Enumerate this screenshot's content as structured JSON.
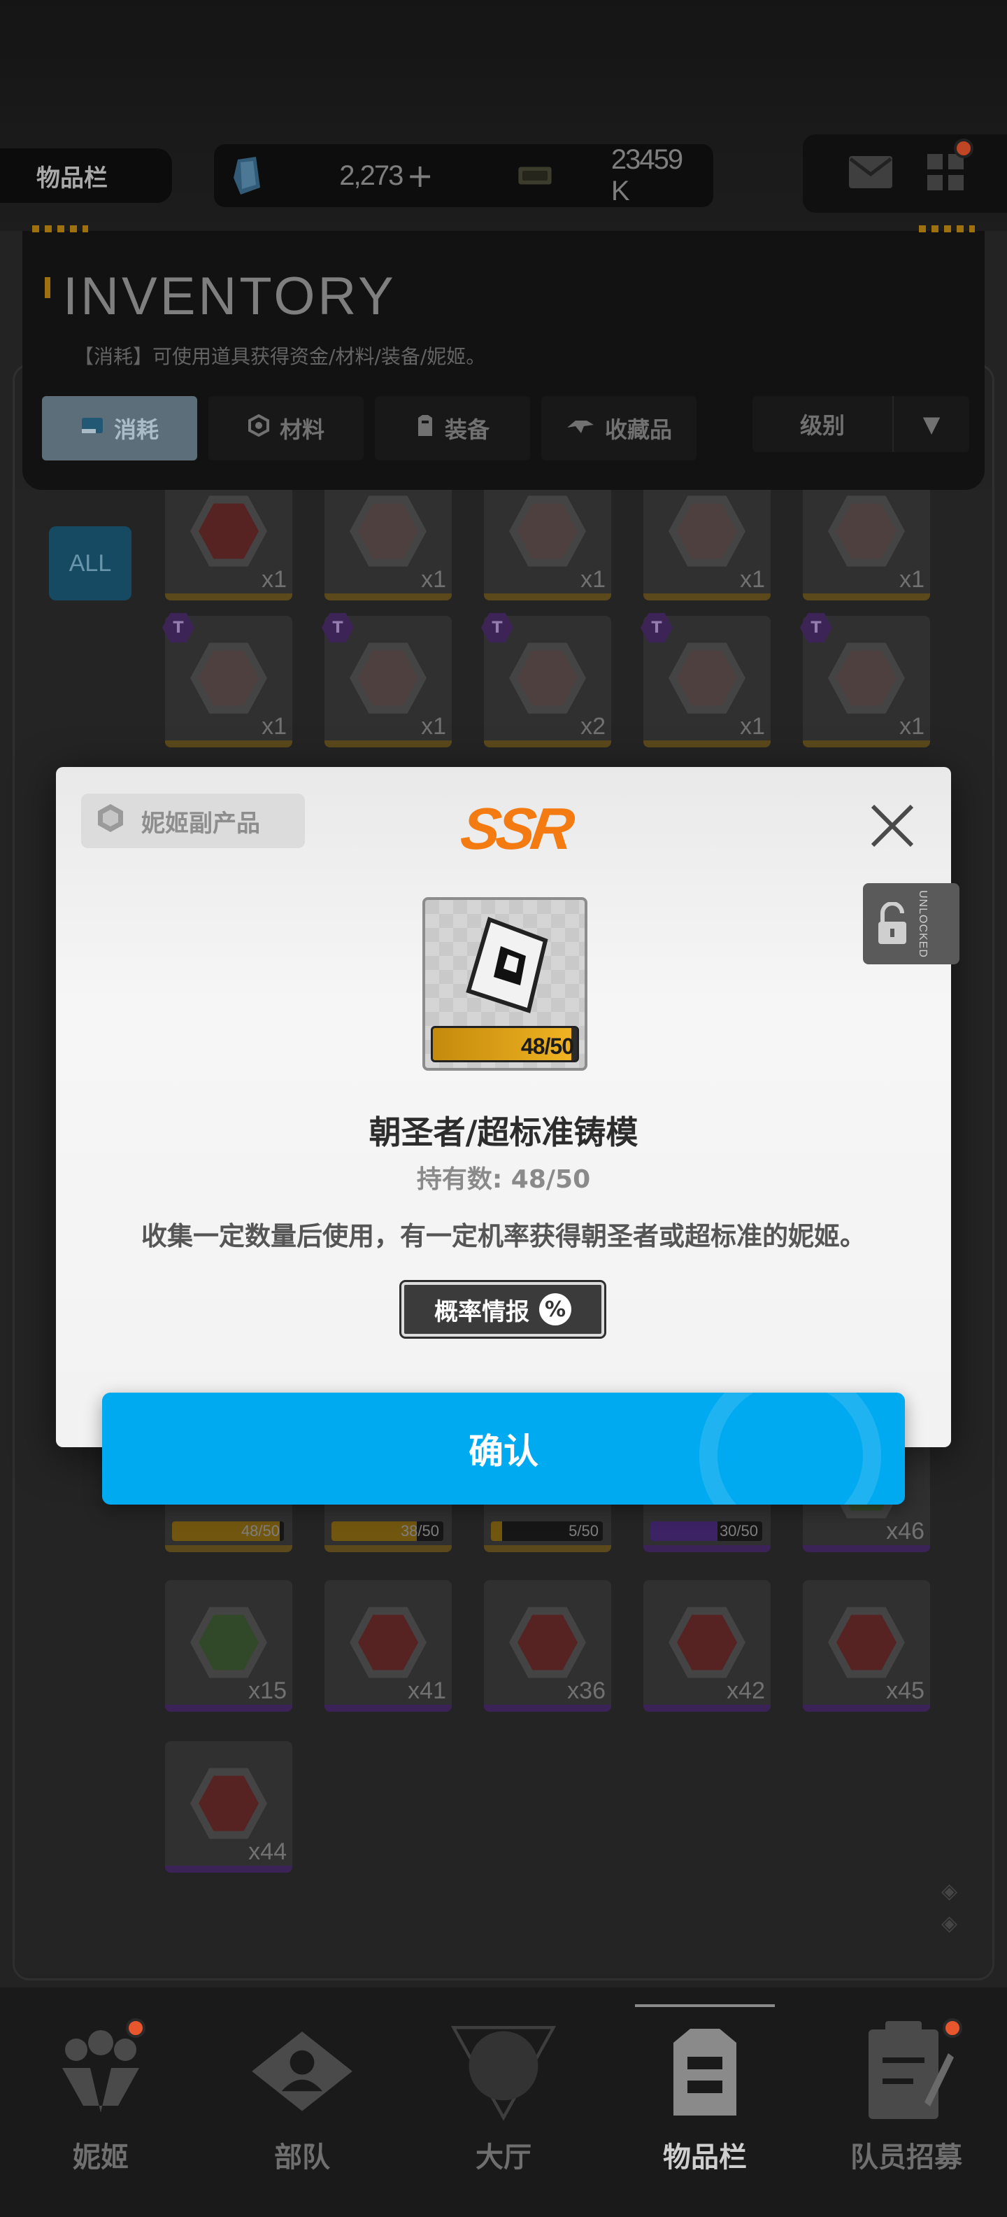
{
  "header": {
    "page_tag": "物品栏",
    "gems": "2,273",
    "gems_add": "+",
    "credits": "23459 K",
    "mail_icon": "mail-icon",
    "menu_icon": "grid-menu-icon"
  },
  "inventory": {
    "title": "INVENTORY",
    "description": "【消耗】可使用道具获得资金/材料/装备/妮姬。",
    "tabs": [
      {
        "label": "消耗",
        "icon": "consumable-icon",
        "active": true
      },
      {
        "label": "材料",
        "icon": "material-icon",
        "active": false
      },
      {
        "label": "装备",
        "icon": "equipment-icon",
        "active": false
      },
      {
        "label": "收藏品",
        "icon": "collectible-icon",
        "active": false
      }
    ],
    "sort_label": "级别",
    "sort_arrow": "▼",
    "filter_all": "ALL"
  },
  "grid": {
    "row1": [
      "x1",
      "x1",
      "x1",
      "x1",
      "x1"
    ],
    "row2": [
      "x1",
      "x1",
      "x2",
      "x1",
      "x1"
    ],
    "row2_badge": "T",
    "row3": [
      {
        "count": "48/50",
        "progress": 0.96
      },
      {
        "count": "38/50",
        "progress": 0.76
      },
      {
        "count": "5/50",
        "progress": 0.1
      },
      {
        "count": "30/50",
        "progress": 0.6
      },
      {
        "count": "x46"
      }
    ],
    "row4": [
      "x15",
      "x41",
      "x36",
      "x42",
      "x45"
    ],
    "row5": [
      "x44"
    ]
  },
  "modal": {
    "tag": "妮姬副产品",
    "rarity": "SSR",
    "item_count": "48/50",
    "item_progress": 0.96,
    "item_name": "朝圣者/超标准铸模",
    "owned": "持有数: 48/50",
    "description": "收集一定数量后使用，有一定机率获得朝圣者或超标准的妮姬。",
    "prob_button": "概率情报",
    "prob_icon": "%",
    "unlock_text": "UNLOCKED",
    "confirm": "确认"
  },
  "bottom_nav": [
    {
      "label": "妮姬",
      "icon": "nikke-icon",
      "badge": true,
      "active": false
    },
    {
      "label": "部队",
      "icon": "squad-icon",
      "badge": false,
      "active": false
    },
    {
      "label": "大厅",
      "icon": "lobby-icon",
      "badge": false,
      "active": false
    },
    {
      "label": "物品栏",
      "icon": "inventory-icon",
      "badge": false,
      "active": true
    },
    {
      "label": "队员招募",
      "icon": "recruit-icon",
      "badge": true,
      "active": false
    }
  ]
}
